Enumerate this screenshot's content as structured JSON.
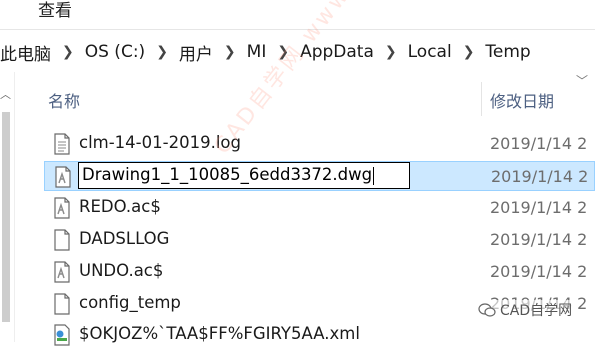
{
  "ribbon": {
    "tab_view": "查看"
  },
  "address": {
    "crumbs": [
      "此电脑",
      "OS (C:)",
      "用户",
      "MI",
      "AppData",
      "Local",
      "Temp"
    ]
  },
  "columns": {
    "name": "名称",
    "date": "修改日期"
  },
  "files": [
    {
      "name": "clm-14-01-2019.log",
      "date": "2019/1/14 2",
      "icon": "text-file-icon"
    },
    {
      "name": "Drawing1_1_10085_6edd3372.dwg",
      "date": "2019/1/14 2",
      "icon": "autocad-file-icon",
      "selected": true,
      "renaming": true
    },
    {
      "name": "REDO.ac$",
      "date": "2019/1/14 2",
      "icon": "autocad-file-icon"
    },
    {
      "name": "DADSLLOG",
      "date": "2019/1/14 2",
      "icon": "blank-file-icon"
    },
    {
      "name": "UNDO.ac$",
      "date": "2019/1/14 2",
      "icon": "autocad-file-icon"
    },
    {
      "name": "config_temp",
      "date": "2019/1/14 2",
      "icon": "blank-file-icon"
    },
    {
      "name": "$OKJOZ%`TAA$FF%FGIRY5AA.xml",
      "date": "",
      "icon": "xml-file-icon"
    }
  ],
  "watermark": {
    "diagonal": "CAD自学网 www.cadzxw.com",
    "brand": "CAD自学网"
  },
  "colors": {
    "selection": "#cce8ff",
    "selection_border": "#99d1ff",
    "header_text": "#4d6082"
  }
}
